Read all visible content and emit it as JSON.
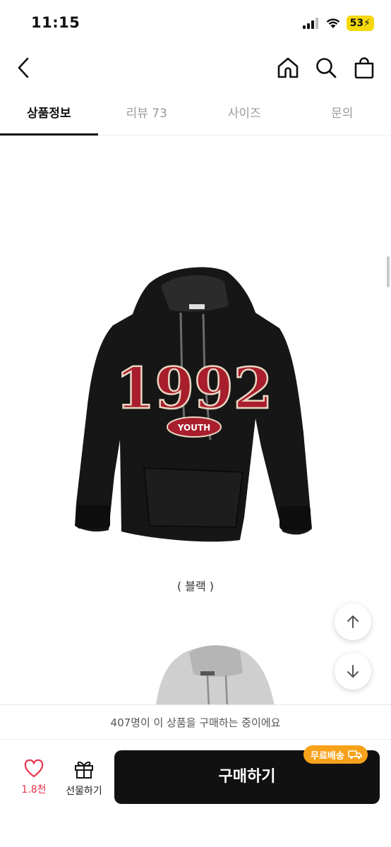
{
  "status_bar": {
    "time": "11:15",
    "battery": "53"
  },
  "nav": {
    "back_icon": "chevron-left-icon",
    "home_icon": "home-icon",
    "search_icon": "search-icon",
    "bag_icon": "shopping-bag-icon"
  },
  "tabs": [
    {
      "label": "상품정보",
      "active": true
    },
    {
      "label": "리뷰 73",
      "active": false
    },
    {
      "label": "사이즈",
      "active": false
    },
    {
      "label": "문의",
      "active": false
    }
  ],
  "product": {
    "hoodie_print": "1992",
    "hoodie_patch": "YOUTH",
    "caption": "( 블랙 )"
  },
  "viewers": "407명이 이 상품을 구매하는 중이에요",
  "bottom": {
    "like_count": "1.8천",
    "gift_label": "선물하기",
    "buy_label": "구매하기",
    "ship_badge": "무료배송"
  },
  "colors": {
    "accent_red": "#e8334a",
    "badge_orange": "#f7a21a",
    "buy_button": "#111111",
    "battery_yellow": "#f5d90a"
  }
}
